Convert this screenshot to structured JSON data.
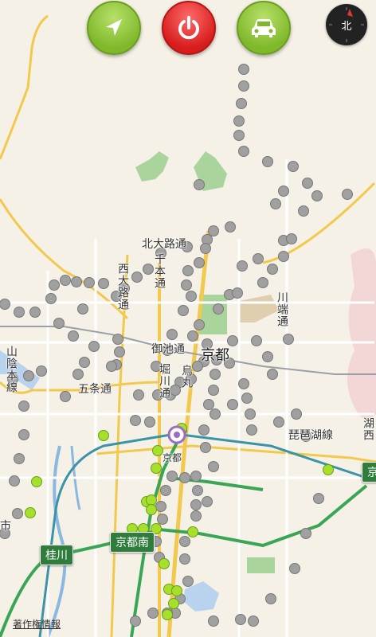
{
  "map": {
    "labels": {
      "kitaoji": "北大路通",
      "senbon": "千本通",
      "nishioji": "西大路通",
      "oike": "御池通",
      "horikawa": "堀川通",
      "karasuma": "烏丸",
      "kyoto_big": "京都",
      "gojo": "五条通",
      "kawabata": "川端通",
      "biwako": "琵琶湖線",
      "sanin": "山陰本線",
      "kyoto_station": "京都",
      "ichi": "市",
      "partial_right": "湖西"
    },
    "shields": {
      "kyotominami": "京都南",
      "katsuragawa": "桂川",
      "edge": "京"
    },
    "credits": "著作権情報"
  },
  "controls": {
    "compass_label": "北",
    "icons": {
      "locate": "location-arrow-icon",
      "power": "power-icon",
      "car": "car-icon"
    }
  },
  "colors": {
    "land": "#f5f1e6",
    "park": "#7cc27c",
    "water": "#8ab8e0",
    "major_road": "#f2c94c",
    "rail_green": "#3aa655",
    "rail_teal": "#3b93a8",
    "stop_grey": "#9e9e9e",
    "stop_green": "#a6e02a",
    "accent_red": "#d71c1c"
  }
}
